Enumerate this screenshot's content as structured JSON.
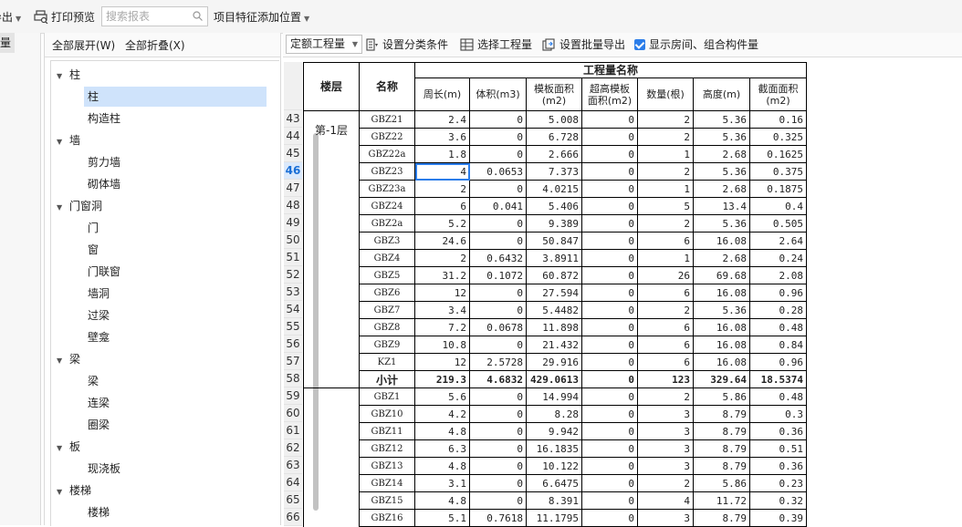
{
  "toolbar": {
    "export_label": "导出",
    "print_preview_label": "打印预览",
    "search_placeholder": "搜索报表",
    "feature_pos_label": "项目特征添加位置"
  },
  "left_strip": {
    "tab_label": "量"
  },
  "tree": {
    "expand_all": "全部展开(W)",
    "collapse_all": "全部折叠(X)",
    "nodes": [
      {
        "label": "柱",
        "level": 0
      },
      {
        "label": "柱",
        "level": 1,
        "selected": true
      },
      {
        "label": "构造柱",
        "level": 1
      },
      {
        "label": "墙",
        "level": 0
      },
      {
        "label": "剪力墙",
        "level": 1
      },
      {
        "label": "砌体墙",
        "level": 1
      },
      {
        "label": "门窗洞",
        "level": 0
      },
      {
        "label": "门",
        "level": 1
      },
      {
        "label": "窗",
        "level": 1
      },
      {
        "label": "门联窗",
        "level": 1
      },
      {
        "label": "墙洞",
        "level": 1
      },
      {
        "label": "过梁",
        "level": 1
      },
      {
        "label": "壁龛",
        "level": 1
      },
      {
        "label": "梁",
        "level": 0
      },
      {
        "label": "梁",
        "level": 1
      },
      {
        "label": "连梁",
        "level": 1
      },
      {
        "label": "圈梁",
        "level": 1
      },
      {
        "label": "板",
        "level": 0
      },
      {
        "label": "现浇板",
        "level": 1
      },
      {
        "label": "楼梯",
        "level": 0
      },
      {
        "label": "楼梯",
        "level": 1
      }
    ]
  },
  "report_bar": {
    "mode_combo": "定额工程量",
    "classify_label": "设置分类条件",
    "select_qty_label": "选择工程量",
    "batch_export_label": "设置批量导出",
    "show_rooms_label": "显示房间、组合构件量",
    "show_rooms_checked": true
  },
  "table": {
    "group_header": "工程量名称",
    "col_floor": "楼层",
    "col_name": "名称",
    "columns": [
      "周长(m)",
      "体积(m3)",
      "模板面积(m2)",
      "超高模板面积(m2)",
      "数量(根)",
      "高度(m)",
      "截面面积(m2)"
    ],
    "floor_label": "第-1层",
    "active_row": "46",
    "rows": [
      {
        "n": "43",
        "name": "GBZ21",
        "v": [
          "2.4",
          "0",
          "5.008",
          "0",
          "2",
          "5.36",
          "0.16"
        ]
      },
      {
        "n": "44",
        "name": "GBZ22",
        "v": [
          "3.6",
          "0",
          "6.728",
          "0",
          "2",
          "5.36",
          "0.325"
        ]
      },
      {
        "n": "45",
        "name": "GBZ22a",
        "v": [
          "1.8",
          "0",
          "2.666",
          "0",
          "1",
          "2.68",
          "0.1625"
        ]
      },
      {
        "n": "46",
        "name": "GBZ23",
        "v": [
          "4",
          "0.0653",
          "7.373",
          "0",
          "2",
          "5.36",
          "0.375"
        ]
      },
      {
        "n": "47",
        "name": "GBZ23a",
        "v": [
          "2",
          "0",
          "4.0215",
          "0",
          "1",
          "2.68",
          "0.1875"
        ]
      },
      {
        "n": "48",
        "name": "GBZ24",
        "v": [
          "6",
          "0.041",
          "5.406",
          "0",
          "5",
          "13.4",
          "0.4"
        ]
      },
      {
        "n": "49",
        "name": "GBZ2a",
        "v": [
          "5.2",
          "0",
          "9.389",
          "0",
          "2",
          "5.36",
          "0.505"
        ]
      },
      {
        "n": "50",
        "name": "GBZ3",
        "v": [
          "24.6",
          "0",
          "50.847",
          "0",
          "6",
          "16.08",
          "2.64"
        ]
      },
      {
        "n": "51",
        "name": "GBZ4",
        "v": [
          "2",
          "0.6432",
          "3.8911",
          "0",
          "1",
          "2.68",
          "0.24"
        ]
      },
      {
        "n": "52",
        "name": "GBZ5",
        "v": [
          "31.2",
          "0.1072",
          "60.872",
          "0",
          "26",
          "69.68",
          "2.08"
        ]
      },
      {
        "n": "53",
        "name": "GBZ6",
        "v": [
          "12",
          "0",
          "27.594",
          "0",
          "6",
          "16.08",
          "0.96"
        ]
      },
      {
        "n": "54",
        "name": "GBZ7",
        "v": [
          "3.4",
          "0",
          "5.4482",
          "0",
          "2",
          "5.36",
          "0.28"
        ]
      },
      {
        "n": "55",
        "name": "GBZ8",
        "v": [
          "7.2",
          "0.0678",
          "11.898",
          "0",
          "6",
          "16.08",
          "0.48"
        ]
      },
      {
        "n": "56",
        "name": "GBZ9",
        "v": [
          "10.8",
          "0",
          "21.432",
          "0",
          "6",
          "16.08",
          "0.84"
        ]
      },
      {
        "n": "57",
        "name": "KZ1",
        "v": [
          "12",
          "2.5728",
          "29.916",
          "0",
          "6",
          "16.08",
          "0.96"
        ]
      },
      {
        "n": "58",
        "name": "小计",
        "v": [
          "219.3",
          "4.6832",
          "429.0613",
          "0",
          "123",
          "329.64",
          "18.5374"
        ],
        "subtotal": true
      },
      {
        "n": "59",
        "name": "GBZ1",
        "v": [
          "5.6",
          "0",
          "14.994",
          "0",
          "2",
          "5.86",
          "0.48"
        ]
      },
      {
        "n": "60",
        "name": "GBZ10",
        "v": [
          "4.2",
          "0",
          "8.28",
          "0",
          "3",
          "8.79",
          "0.3"
        ]
      },
      {
        "n": "61",
        "name": "GBZ11",
        "v": [
          "4.8",
          "0",
          "9.942",
          "0",
          "3",
          "8.79",
          "0.36"
        ]
      },
      {
        "n": "62",
        "name": "GBZ12",
        "v": [
          "6.3",
          "0",
          "16.1835",
          "0",
          "3",
          "8.79",
          "0.51"
        ]
      },
      {
        "n": "63",
        "name": "GBZ13",
        "v": [
          "4.8",
          "0",
          "10.122",
          "0",
          "3",
          "8.79",
          "0.36"
        ]
      },
      {
        "n": "64",
        "name": "GBZ14",
        "v": [
          "3.1",
          "0",
          "6.6475",
          "0",
          "2",
          "5.86",
          "0.23"
        ]
      },
      {
        "n": "65",
        "name": "GBZ15",
        "v": [
          "4.8",
          "0",
          "8.391",
          "0",
          "4",
          "11.72",
          "0.32"
        ]
      },
      {
        "n": "66",
        "name": "GBZ16",
        "v": [
          "5.1",
          "0.7618",
          "11.1795",
          "0",
          "3",
          "8.79",
          "0.39"
        ]
      }
    ]
  }
}
